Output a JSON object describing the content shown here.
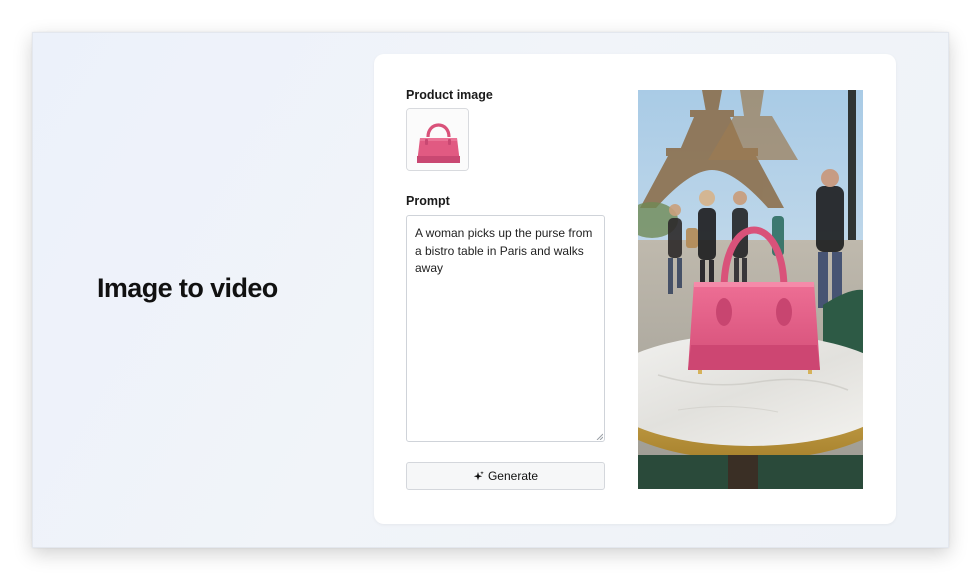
{
  "heading": "Image to video",
  "form": {
    "product_image_label": "Product image",
    "prompt_label": "Prompt",
    "prompt_value": "A woman picks up the purse from a bistro table in Paris and walks away",
    "generate_label": "Generate",
    "generate_icon": "sparkle-icon"
  },
  "colors": {
    "bag_pink": "#e15a82",
    "background": "#eef2f8",
    "panel": "#ffffff"
  }
}
